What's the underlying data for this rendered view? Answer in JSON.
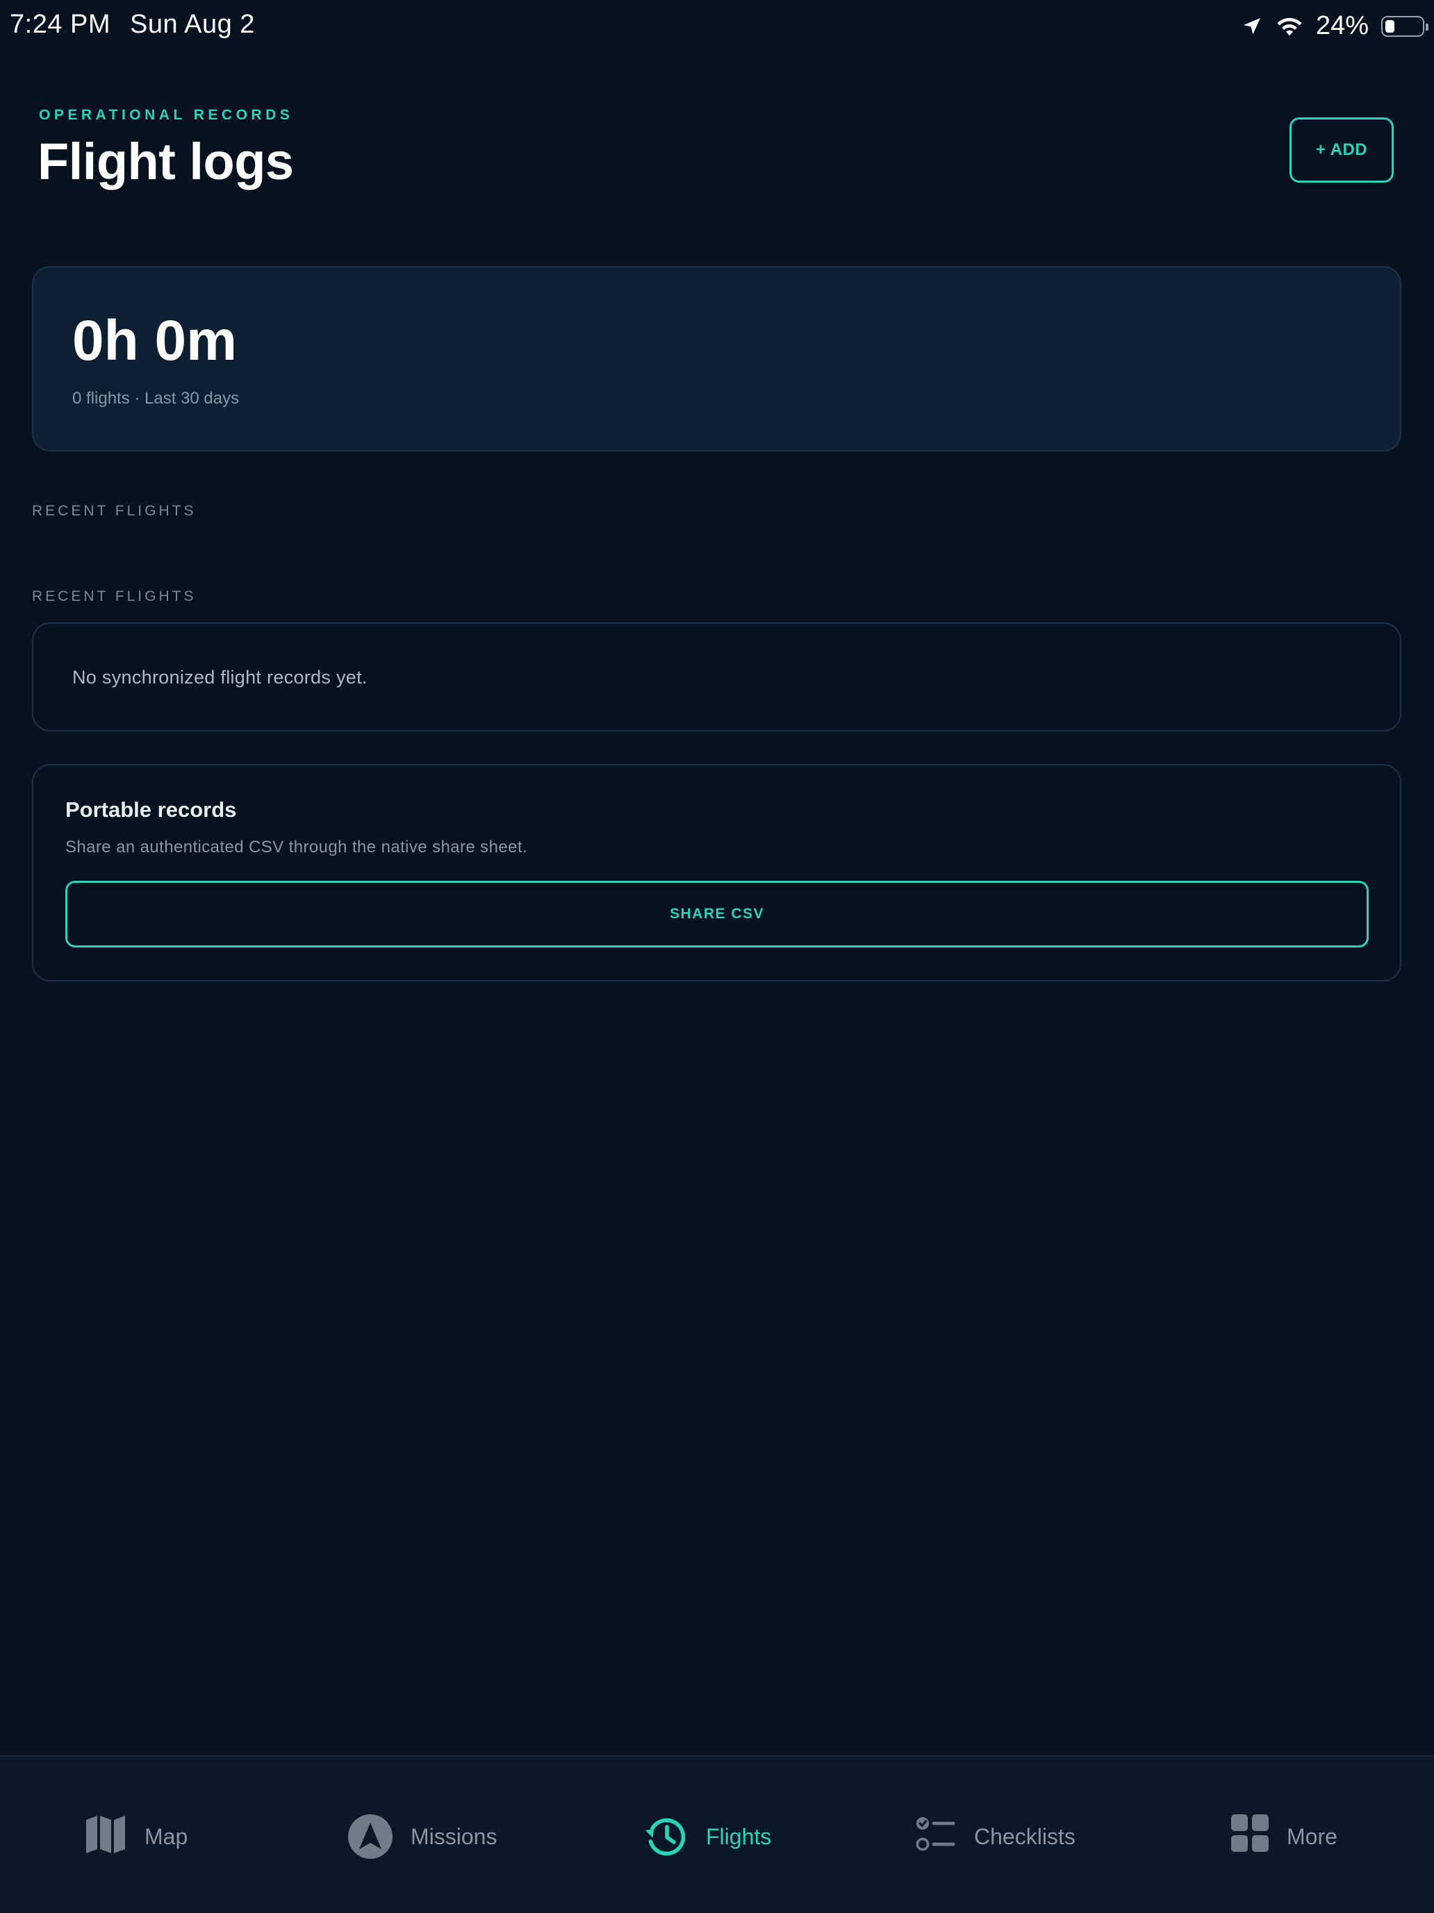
{
  "status_bar": {
    "time": "7:24 PM",
    "date": "Sun Aug 2",
    "battery_percent": "24%",
    "battery_level": 0.24,
    "icons": [
      "location-arrow-icon",
      "wifi-icon",
      "battery-icon"
    ]
  },
  "header": {
    "eyebrow": "OPERATIONAL RECORDS",
    "title": "Flight logs",
    "add_label": "+ ADD"
  },
  "summary": {
    "total_time": "0h 0m",
    "subtitle": "0 flights · Last 30 days"
  },
  "sections": {
    "recent_label_1": "RECENT FLIGHTS",
    "recent_label_2": "RECENT FLIGHTS"
  },
  "empty_state": {
    "message": "No synchronized flight records yet."
  },
  "portable": {
    "title": "Portable records",
    "description": "Share an authenticated CSV through the native share sheet.",
    "button_label": "SHARE CSV"
  },
  "tabs": [
    {
      "label": "Map",
      "icon": "map-icon",
      "active": false
    },
    {
      "label": "Missions",
      "icon": "navigation-arrow-icon",
      "active": false
    },
    {
      "label": "Flights",
      "icon": "history-icon",
      "active": true
    },
    {
      "label": "Checklists",
      "icon": "checklist-icon",
      "active": false
    },
    {
      "label": "More",
      "icon": "grid-icon",
      "active": false
    }
  ],
  "colors": {
    "background": "#071220",
    "accent": "#28d5b8",
    "card": "#0d2031",
    "muted_text": "#8897a6"
  }
}
